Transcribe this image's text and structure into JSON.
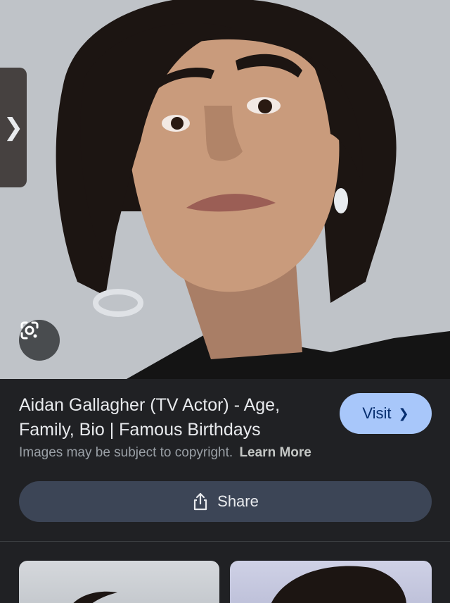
{
  "result": {
    "title": "Aidan Gallagher (TV Actor) - Age, Family, Bio | Famous Birthdays",
    "visit_label": "Visit",
    "visit_icon": "chevron-right-icon",
    "copyright_text": "Images may be subject to copyright.",
    "learn_more_label": "Learn More",
    "share_label": "Share",
    "share_icon": "share-icon"
  },
  "hero": {
    "side_tab_icon": "chevron-right-icon",
    "lens_icon": "google-lens-icon"
  },
  "related": {
    "thumbnails": 2
  },
  "colors": {
    "background": "#202124",
    "visit_button": "#a8c7fa",
    "share_button": "#3c4556"
  }
}
